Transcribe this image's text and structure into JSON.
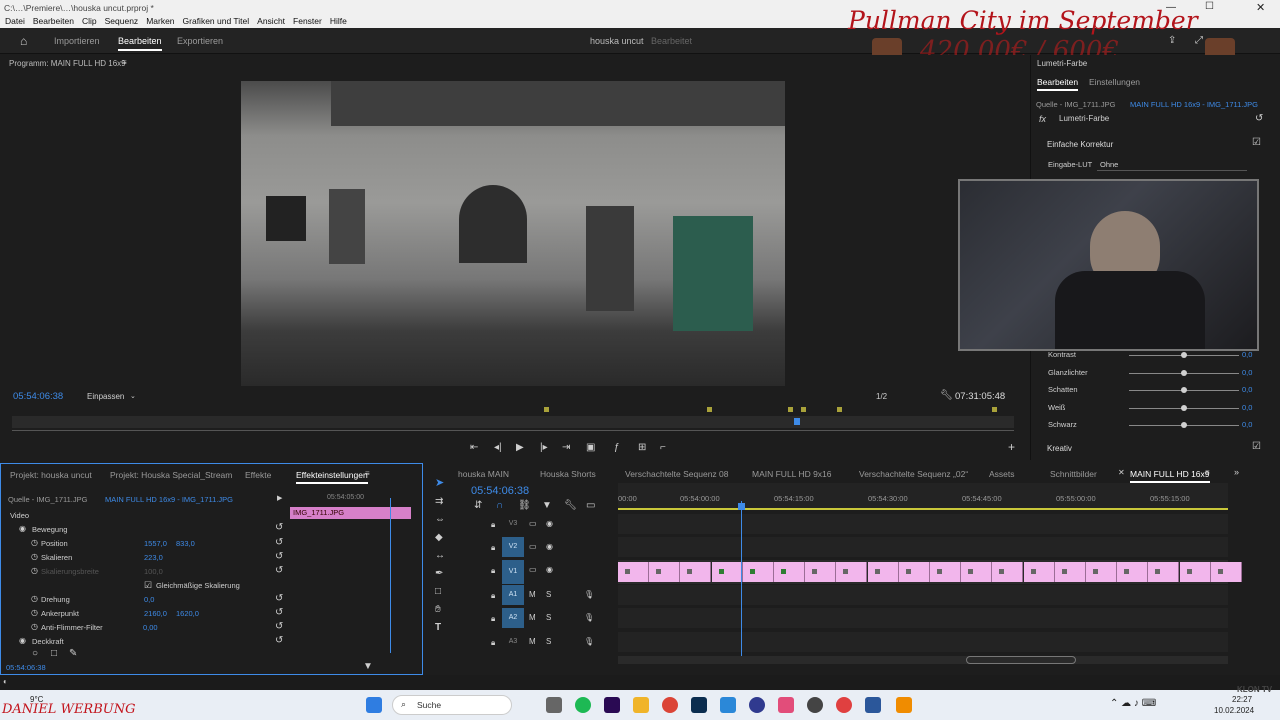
{
  "titlebar": {
    "title": "C:\\…\\Premiere\\…\\houska uncut.prproj *"
  },
  "menu": [
    "Datei",
    "Bearbeiten",
    "Clip",
    "Sequenz",
    "Marken",
    "Grafiken und Titel",
    "Ansicht",
    "Fenster",
    "Hilfe"
  ],
  "workspaces": {
    "import": "Importieren",
    "edit": "Bearbeiten",
    "export": "Exportieren",
    "project_name": "houska uncut",
    "project_status": "Bearbeitet"
  },
  "overlay": {
    "title": "Pullman City im September",
    "price": "420.00€ / 600€"
  },
  "program": {
    "label": "Programm: MAIN FULL HD 16x9",
    "timecode_current": "05:54:06:38",
    "fit": "Einpassen",
    "resolution": "1/2",
    "timecode_total": "07:31:05:48"
  },
  "lumetri": {
    "panel": "Lumetri-Farbe",
    "tab_edit": "Bearbeiten",
    "tab_settings": "Einstellungen",
    "source": "Quelle - IMG_1711.JPG",
    "sequence": "MAIN FULL HD 16x9 - IMG_1711.JPG",
    "effect": "Lumetri-Farbe",
    "section": "Einfache Korrektur",
    "lut_label": "Eingabe-LUT",
    "lut_value": "Ohne",
    "creative": "Kreativ",
    "rows": [
      {
        "label": "Kontrast",
        "value": "0,0",
        "level": 0.5
      },
      {
        "label": "Glanzlichter",
        "value": "0,0",
        "level": 0.5
      },
      {
        "label": "Schatten",
        "value": "0,0",
        "level": 0.5
      },
      {
        "label": "Weiß",
        "value": "0,0",
        "level": 0.5
      },
      {
        "label": "Schwarz",
        "value": "0,0",
        "level": 0.5
      }
    ]
  },
  "effects": {
    "tabs": [
      "Projekt: houska uncut",
      "Projekt: Houska Special_Stream",
      "Effekte",
      "Effekteinstellungen"
    ],
    "source": "Quelle - IMG_1711.JPG",
    "sequence": "MAIN FULL HD 16x9 - IMG_1711.JPG",
    "mini_time": "05:54:05:00",
    "clip": "IMG_1711.JPG",
    "video": "Video",
    "motion": "Bewegung",
    "props": [
      {
        "name": "Position",
        "v1": "1557,0",
        "v2": "833,0"
      },
      {
        "name": "Skalieren",
        "v1": "223,0",
        "v2": ""
      },
      {
        "name": "Skalierungsbreite",
        "v1": "100,0",
        "v2": ""
      },
      {
        "name": "Drehung",
        "v1": "0,0",
        "v2": ""
      },
      {
        "name": "Ankerpunkt",
        "v1": "2160,0",
        "v2": "1620,0"
      },
      {
        "name": "Anti-Flimmer-Filter",
        "v1": "0,00",
        "v2": ""
      }
    ],
    "uniform": "Gleichmäßige Skalierung",
    "opacity": "Deckkraft",
    "timecode": "05:54:06:38"
  },
  "timeline": {
    "tabs": [
      "houska MAIN",
      "Houska Shorts",
      "Verschachtelte Sequenz 08",
      "MAIN FULL HD 9x16",
      "Verschachtelte Sequenz „02“",
      "Assets",
      "Schnittbilder",
      "MAIN FULL HD 16x9"
    ],
    "timecode": "05:54:06:38",
    "ruler": [
      "00:00",
      "05:54:00:00",
      "05:54:15:00",
      "05:54:30:00",
      "05:54:45:00",
      "05:55:00:00",
      "05:55:15:00"
    ],
    "tracks": [
      "V3",
      "V2",
      "V1",
      "A1",
      "A2",
      "A3"
    ]
  },
  "taskbar": {
    "weather_temp": "9°C",
    "search": "Suche",
    "time": "22:27",
    "date": "10.02.2024"
  },
  "watermark": {
    "left": "DANIEL WERBUNG",
    "right": "KLON TV"
  }
}
